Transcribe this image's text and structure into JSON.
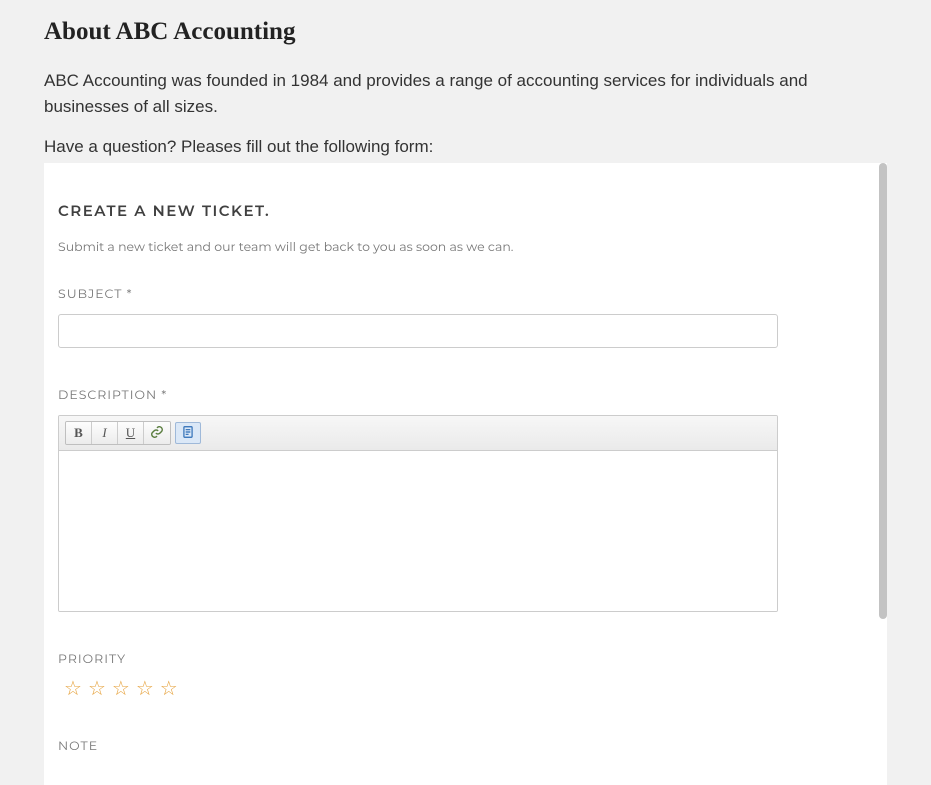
{
  "page": {
    "title": "About ABC Accounting",
    "intro": "ABC Accounting was founded in 1984 and provides a range of accounting services for individuals and businesses of all sizes.",
    "prompt": "Have a question? Pleases fill out the following form:"
  },
  "form": {
    "heading": "CREATE A NEW TICKET.",
    "subtext": "Submit a new ticket and our team will get back to you as soon as we can.",
    "fields": {
      "subject": {
        "label": "SUBJECT *",
        "value": ""
      },
      "description": {
        "label": "DESCRIPTION *",
        "value": ""
      },
      "priority": {
        "label": "PRIORITY",
        "value": 0,
        "max": 5
      },
      "note": {
        "label": "NOTE",
        "value": ""
      }
    },
    "editor_toolbar": {
      "bold": "B",
      "italic": "I",
      "underline": "U"
    }
  }
}
